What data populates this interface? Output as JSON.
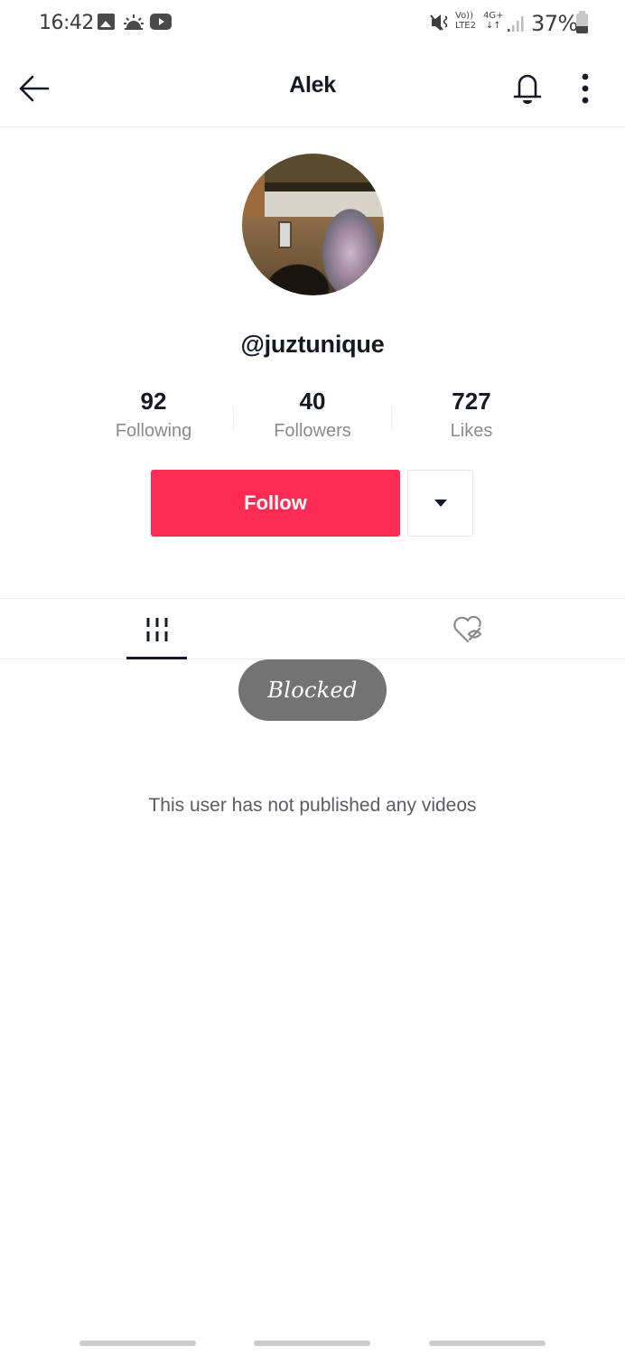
{
  "status_bar": {
    "time": "16:42",
    "notification_icons": [
      "gallery-icon",
      "weather-sunrise-icon",
      "youtube-icon"
    ],
    "volte_line1": "Vo))",
    "volte_line2": "LTE2",
    "network_type": "4G+",
    "network_arrows": "↓↑",
    "battery_percent": "37%"
  },
  "header": {
    "title": "Alek",
    "back_icon": "arrow-left-icon",
    "bell_icon": "bell-icon",
    "more_icon": "more-vertical-icon"
  },
  "profile": {
    "username": "@juztunique",
    "stats": [
      {
        "value": "92",
        "label": "Following"
      },
      {
        "value": "40",
        "label": "Followers"
      },
      {
        "value": "727",
        "label": "Likes"
      }
    ],
    "follow_label": "Follow",
    "accent_color": "#fe2c55"
  },
  "tabs": [
    {
      "name": "videos",
      "icon": "grid-icon",
      "active": true
    },
    {
      "name": "liked",
      "icon": "hidden-heart-icon",
      "active": false
    }
  ],
  "toast": {
    "text": "Blocked"
  },
  "empty_state": {
    "text": "This user has not published any videos"
  }
}
